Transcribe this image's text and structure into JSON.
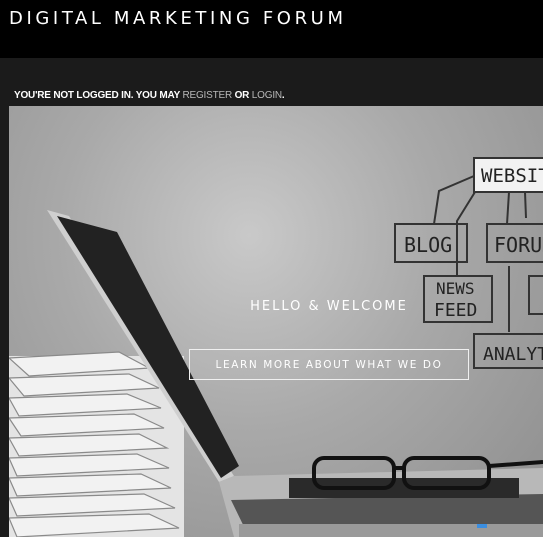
{
  "site": {
    "title": "DIGITAL MARKETING FORUM"
  },
  "notice": {
    "prefix": "YOU'RE NOT LOGGED IN. YOU MAY",
    "register": "REGISTER",
    "or": "OR",
    "login": "LOGIN",
    "suffix": "."
  },
  "hero": {
    "heading": "HELLO & WELCOME",
    "button": "LEARN MORE ABOUT WHAT WE DO",
    "sketch_labels": {
      "website": "WEBSITE",
      "blog": "BLOG",
      "forum": "FORUM",
      "news": "NEWS",
      "feed": "FEED",
      "analytics": "ANALYTICS"
    }
  }
}
